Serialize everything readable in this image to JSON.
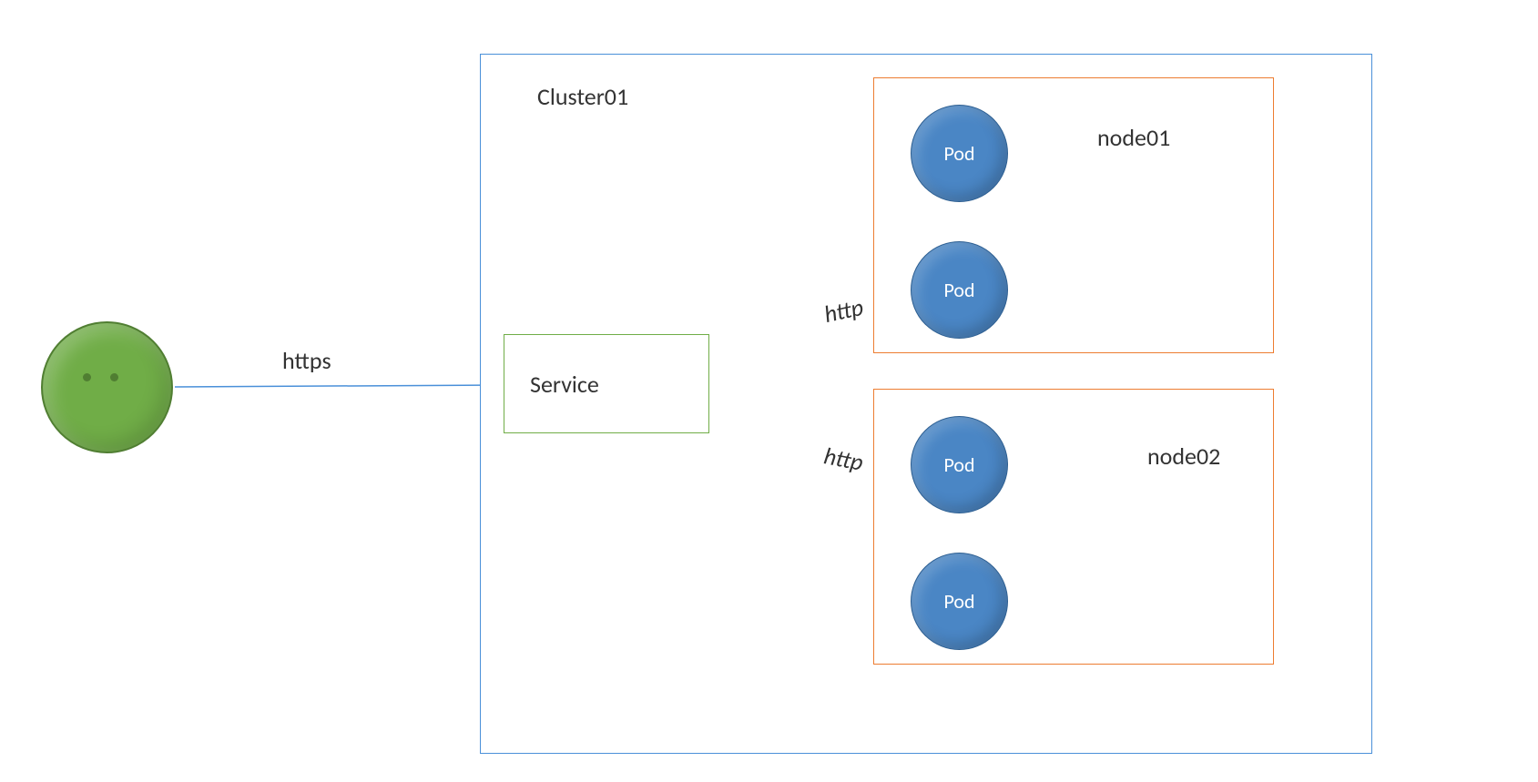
{
  "diagram": {
    "cluster": {
      "label": "Cluster01",
      "service": {
        "label": "Service"
      },
      "nodes": [
        {
          "label": "node01",
          "pods": [
            {
              "label": "Pod"
            },
            {
              "label": "Pod"
            }
          ]
        },
        {
          "label": "node02",
          "pods": [
            {
              "label": "Pod"
            },
            {
              "label": "Pod"
            }
          ]
        }
      ]
    },
    "edges": {
      "clientToService": "https",
      "serviceToPod1": "http",
      "serviceToPod2": "http"
    },
    "colors": {
      "clusterBorder": "#4a90d9",
      "nodeBorder": "#ed7d31",
      "serviceBorder": "#70ad47",
      "podFill": "#4a86c5",
      "clientFill": "#70ad47",
      "arrow": "#4a90d9"
    }
  }
}
